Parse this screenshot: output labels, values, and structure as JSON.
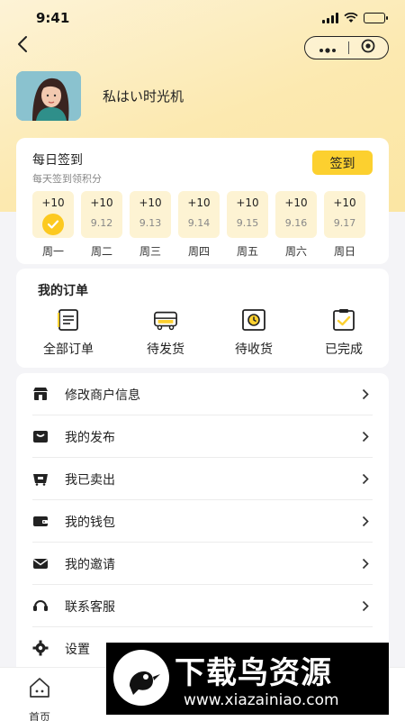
{
  "status_bar": {
    "time": "9:41"
  },
  "profile": {
    "username": "私はい时光机"
  },
  "checkin": {
    "title": "每日签到",
    "subtitle": "每天签到领积分",
    "button_label": "签到",
    "days": [
      {
        "points": "+10",
        "date": "",
        "label": "周一",
        "checked": true
      },
      {
        "points": "+10",
        "date": "9.12",
        "label": "周二",
        "checked": false
      },
      {
        "points": "+10",
        "date": "9.13",
        "label": "周三",
        "checked": false
      },
      {
        "points": "+10",
        "date": "9.14",
        "label": "周四",
        "checked": false
      },
      {
        "points": "+10",
        "date": "9.15",
        "label": "周五",
        "checked": false
      },
      {
        "points": "+10",
        "date": "9.16",
        "label": "周六",
        "checked": false
      },
      {
        "points": "+10",
        "date": "9.17",
        "label": "周日",
        "checked": false
      }
    ]
  },
  "orders": {
    "title": "我的订单",
    "items": [
      {
        "label": "全部订单",
        "icon": "document-list-icon"
      },
      {
        "label": "待发货",
        "icon": "delivery-box-icon"
      },
      {
        "label": "待收货",
        "icon": "clock-box-icon"
      },
      {
        "label": "已完成",
        "icon": "checked-clipboard-icon"
      }
    ]
  },
  "menu": {
    "items": [
      {
        "label": "修改商户信息",
        "icon": "store-icon"
      },
      {
        "label": "我的发布",
        "icon": "shopping-bag-icon"
      },
      {
        "label": "我已卖出",
        "icon": "sold-cart-icon"
      },
      {
        "label": "我的钱包",
        "icon": "wallet-icon"
      },
      {
        "label": "我的邀请",
        "icon": "envelope-icon"
      },
      {
        "label": "联系客服",
        "icon": "headset-icon"
      },
      {
        "label": "设置",
        "icon": "gear-icon"
      }
    ]
  },
  "tabbar": {
    "home_label": "首页"
  },
  "watermark": {
    "title": "下载鸟资源",
    "url": "www.xiazainiao.com"
  },
  "colors": {
    "accent": "#fcd02f",
    "day_box": "#fdf3d3",
    "check": "#fcc91f"
  }
}
